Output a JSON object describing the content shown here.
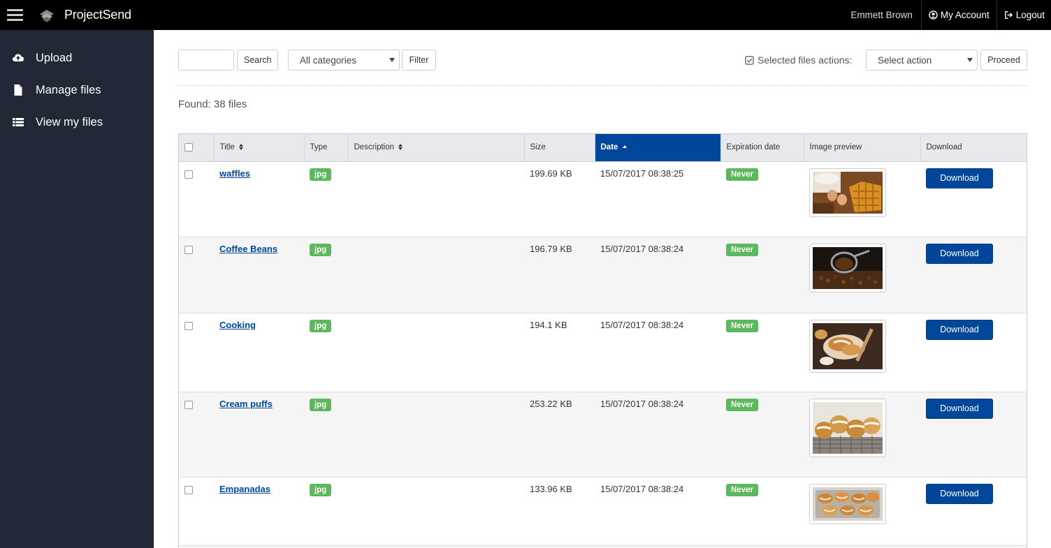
{
  "header": {
    "app_name": "ProjectSend",
    "user_name": "Emmett Brown",
    "account_label": "My Account",
    "logout_label": "Logout"
  },
  "sidebar": {
    "items": [
      {
        "label": "Upload",
        "icon": "cloud-upload-icon"
      },
      {
        "label": "Manage files",
        "icon": "file-icon"
      },
      {
        "label": "View my files",
        "icon": "list-icon"
      }
    ]
  },
  "toolbar": {
    "search_value": "",
    "search_button": "Search",
    "category_selected": "All categories",
    "filter_button": "Filter",
    "selected_actions_label": "Selected files actions:",
    "action_selected": "Select action",
    "proceed_button": "Proceed"
  },
  "found_text": "Found: 38 files",
  "table": {
    "headers": {
      "title": "Title",
      "type": "Type",
      "description": "Description",
      "size": "Size",
      "date": "Date",
      "expiration": "Expiration date",
      "preview": "Image preview",
      "download": "Download"
    },
    "rows": [
      {
        "title": "waffles",
        "type": "jpg",
        "description": "",
        "size": "199.69 KB",
        "date": "15/07/2017 08:38:25",
        "expiration": "Never",
        "download_label": "Download",
        "preview": "waffles-image"
      },
      {
        "title": "Coffee Beans",
        "type": "jpg",
        "description": "",
        "size": "196.79 KB",
        "date": "15/07/2017 08:38:24",
        "expiration": "Never",
        "download_label": "Download",
        "preview": "coffee-beans-image"
      },
      {
        "title": "Cooking",
        "type": "jpg",
        "description": "",
        "size": "194.1 KB",
        "date": "15/07/2017 08:38:24",
        "expiration": "Never",
        "download_label": "Download",
        "preview": "cooking-image"
      },
      {
        "title": "Cream puffs",
        "type": "jpg",
        "description": "",
        "size": "253.22 KB",
        "date": "15/07/2017 08:38:24",
        "expiration": "Never",
        "download_label": "Download",
        "preview": "cream-puffs-image"
      },
      {
        "title": "Empanadas",
        "type": "jpg",
        "description": "",
        "size": "133.96 KB",
        "date": "15/07/2017 08:38:24",
        "expiration": "Never",
        "download_label": "Download",
        "preview": "empanadas-image"
      }
    ]
  },
  "colors": {
    "topbar": "#000000",
    "sidebar": "#222836",
    "accent": "#00479b",
    "badge_green": "#5cb85c"
  }
}
